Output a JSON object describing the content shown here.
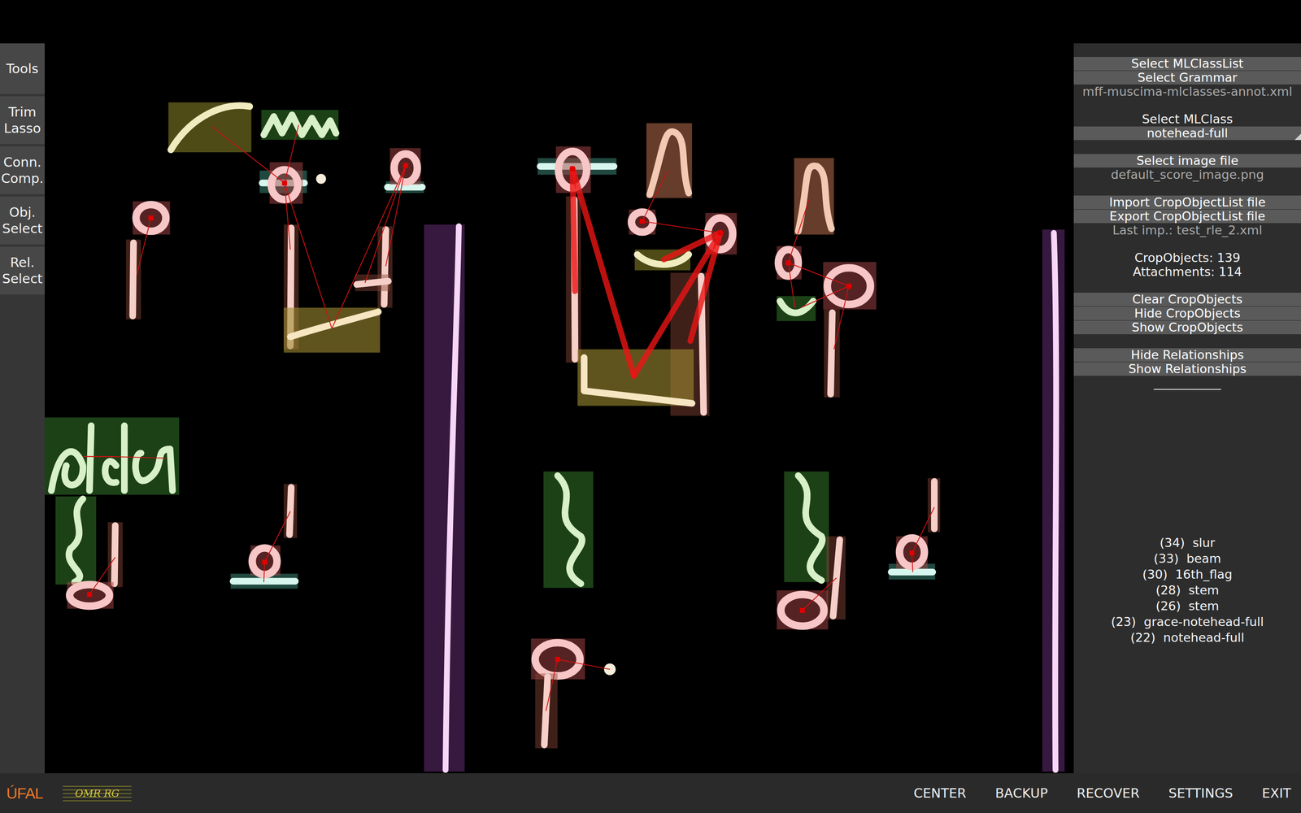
{
  "toolbar": {
    "title": "Tools",
    "tools": [
      {
        "label": "Trim Lasso",
        "selected": false
      },
      {
        "label": "Conn. Comp.",
        "selected": false
      },
      {
        "label": "Obj. Select",
        "selected": false
      },
      {
        "label": "Rel. Select",
        "selected": false
      }
    ]
  },
  "panel": {
    "groups": [
      [
        {
          "kind": "button",
          "text": "Select MLClassList"
        },
        {
          "kind": "button",
          "text": "Select Grammar"
        },
        {
          "kind": "info",
          "text": "mff-muscima-mlclasses-annot.xml"
        }
      ],
      [
        {
          "kind": "label",
          "text": "Select MLClass"
        },
        {
          "kind": "spinner",
          "text": "notehead-full"
        }
      ],
      [
        {
          "kind": "button",
          "text": "Select image file"
        },
        {
          "kind": "info",
          "text": "default_score_image.png"
        }
      ],
      [
        {
          "kind": "button",
          "text": "Import CropObjectList file"
        },
        {
          "kind": "button",
          "text": "Export CropObjectList file"
        },
        {
          "kind": "info",
          "text": "Last imp.: test_rle_2.xml"
        }
      ],
      [
        {
          "kind": "label",
          "text": "CropObjects: 139"
        },
        {
          "kind": "label",
          "text": "Attachments: 114"
        }
      ],
      [
        {
          "kind": "button",
          "text": "Clear CropObjects"
        },
        {
          "kind": "button",
          "text": "Hide CropObjects"
        },
        {
          "kind": "button",
          "text": "Show CropObjects"
        }
      ],
      [
        {
          "kind": "button",
          "text": "Hide Relationships"
        },
        {
          "kind": "button",
          "text": "Show Relationships"
        },
        {
          "kind": "label",
          "text": "___________"
        }
      ]
    ]
  },
  "selection": [
    {
      "index": "(34)",
      "label": "slur"
    },
    {
      "index": "(33)",
      "label": "beam"
    },
    {
      "index": "(30)",
      "label": "16th_flag"
    },
    {
      "index": "(28)",
      "label": "stem"
    },
    {
      "index": "(26)",
      "label": "stem"
    },
    {
      "index": "(23)",
      "label": "grace-notehead-full"
    },
    {
      "index": "(22)",
      "label": "notehead-full"
    }
  ],
  "bottom_bar": {
    "logos": {
      "ufal": "ÚFAL",
      "omr": "OMR RG"
    },
    "buttons": [
      "CENTER",
      "BACKUP",
      "RECOVER",
      "SETTINGS",
      "EXIT"
    ]
  }
}
